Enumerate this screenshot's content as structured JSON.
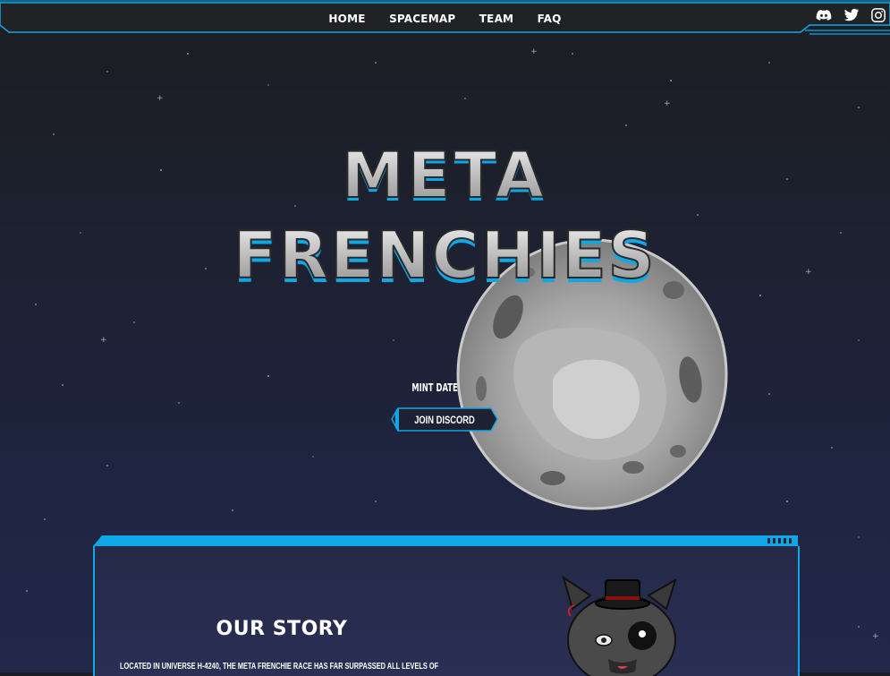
{
  "nav": {
    "links": [
      "HOME",
      "SPACEMAP",
      "TEAM",
      "FAQ"
    ],
    "socials": [
      "discord-icon",
      "twitter-icon",
      "instagram-icon"
    ]
  },
  "hero": {
    "title_line1": "META",
    "title_line2": "FRENCHIES",
    "mint_date_label": "MINT DATE",
    "join_button": "JOIN DISCORD"
  },
  "story": {
    "title": "OUR STORY",
    "text": "LOCATED IN UNIVERSE H-4240, THE META FRENCHIE RACE HAS FAR SURPASSED ALL LEVELS OF"
  },
  "colors": {
    "accent": "#0fa7e6",
    "background": "#1e2238",
    "moon": "#9a9a9a"
  }
}
